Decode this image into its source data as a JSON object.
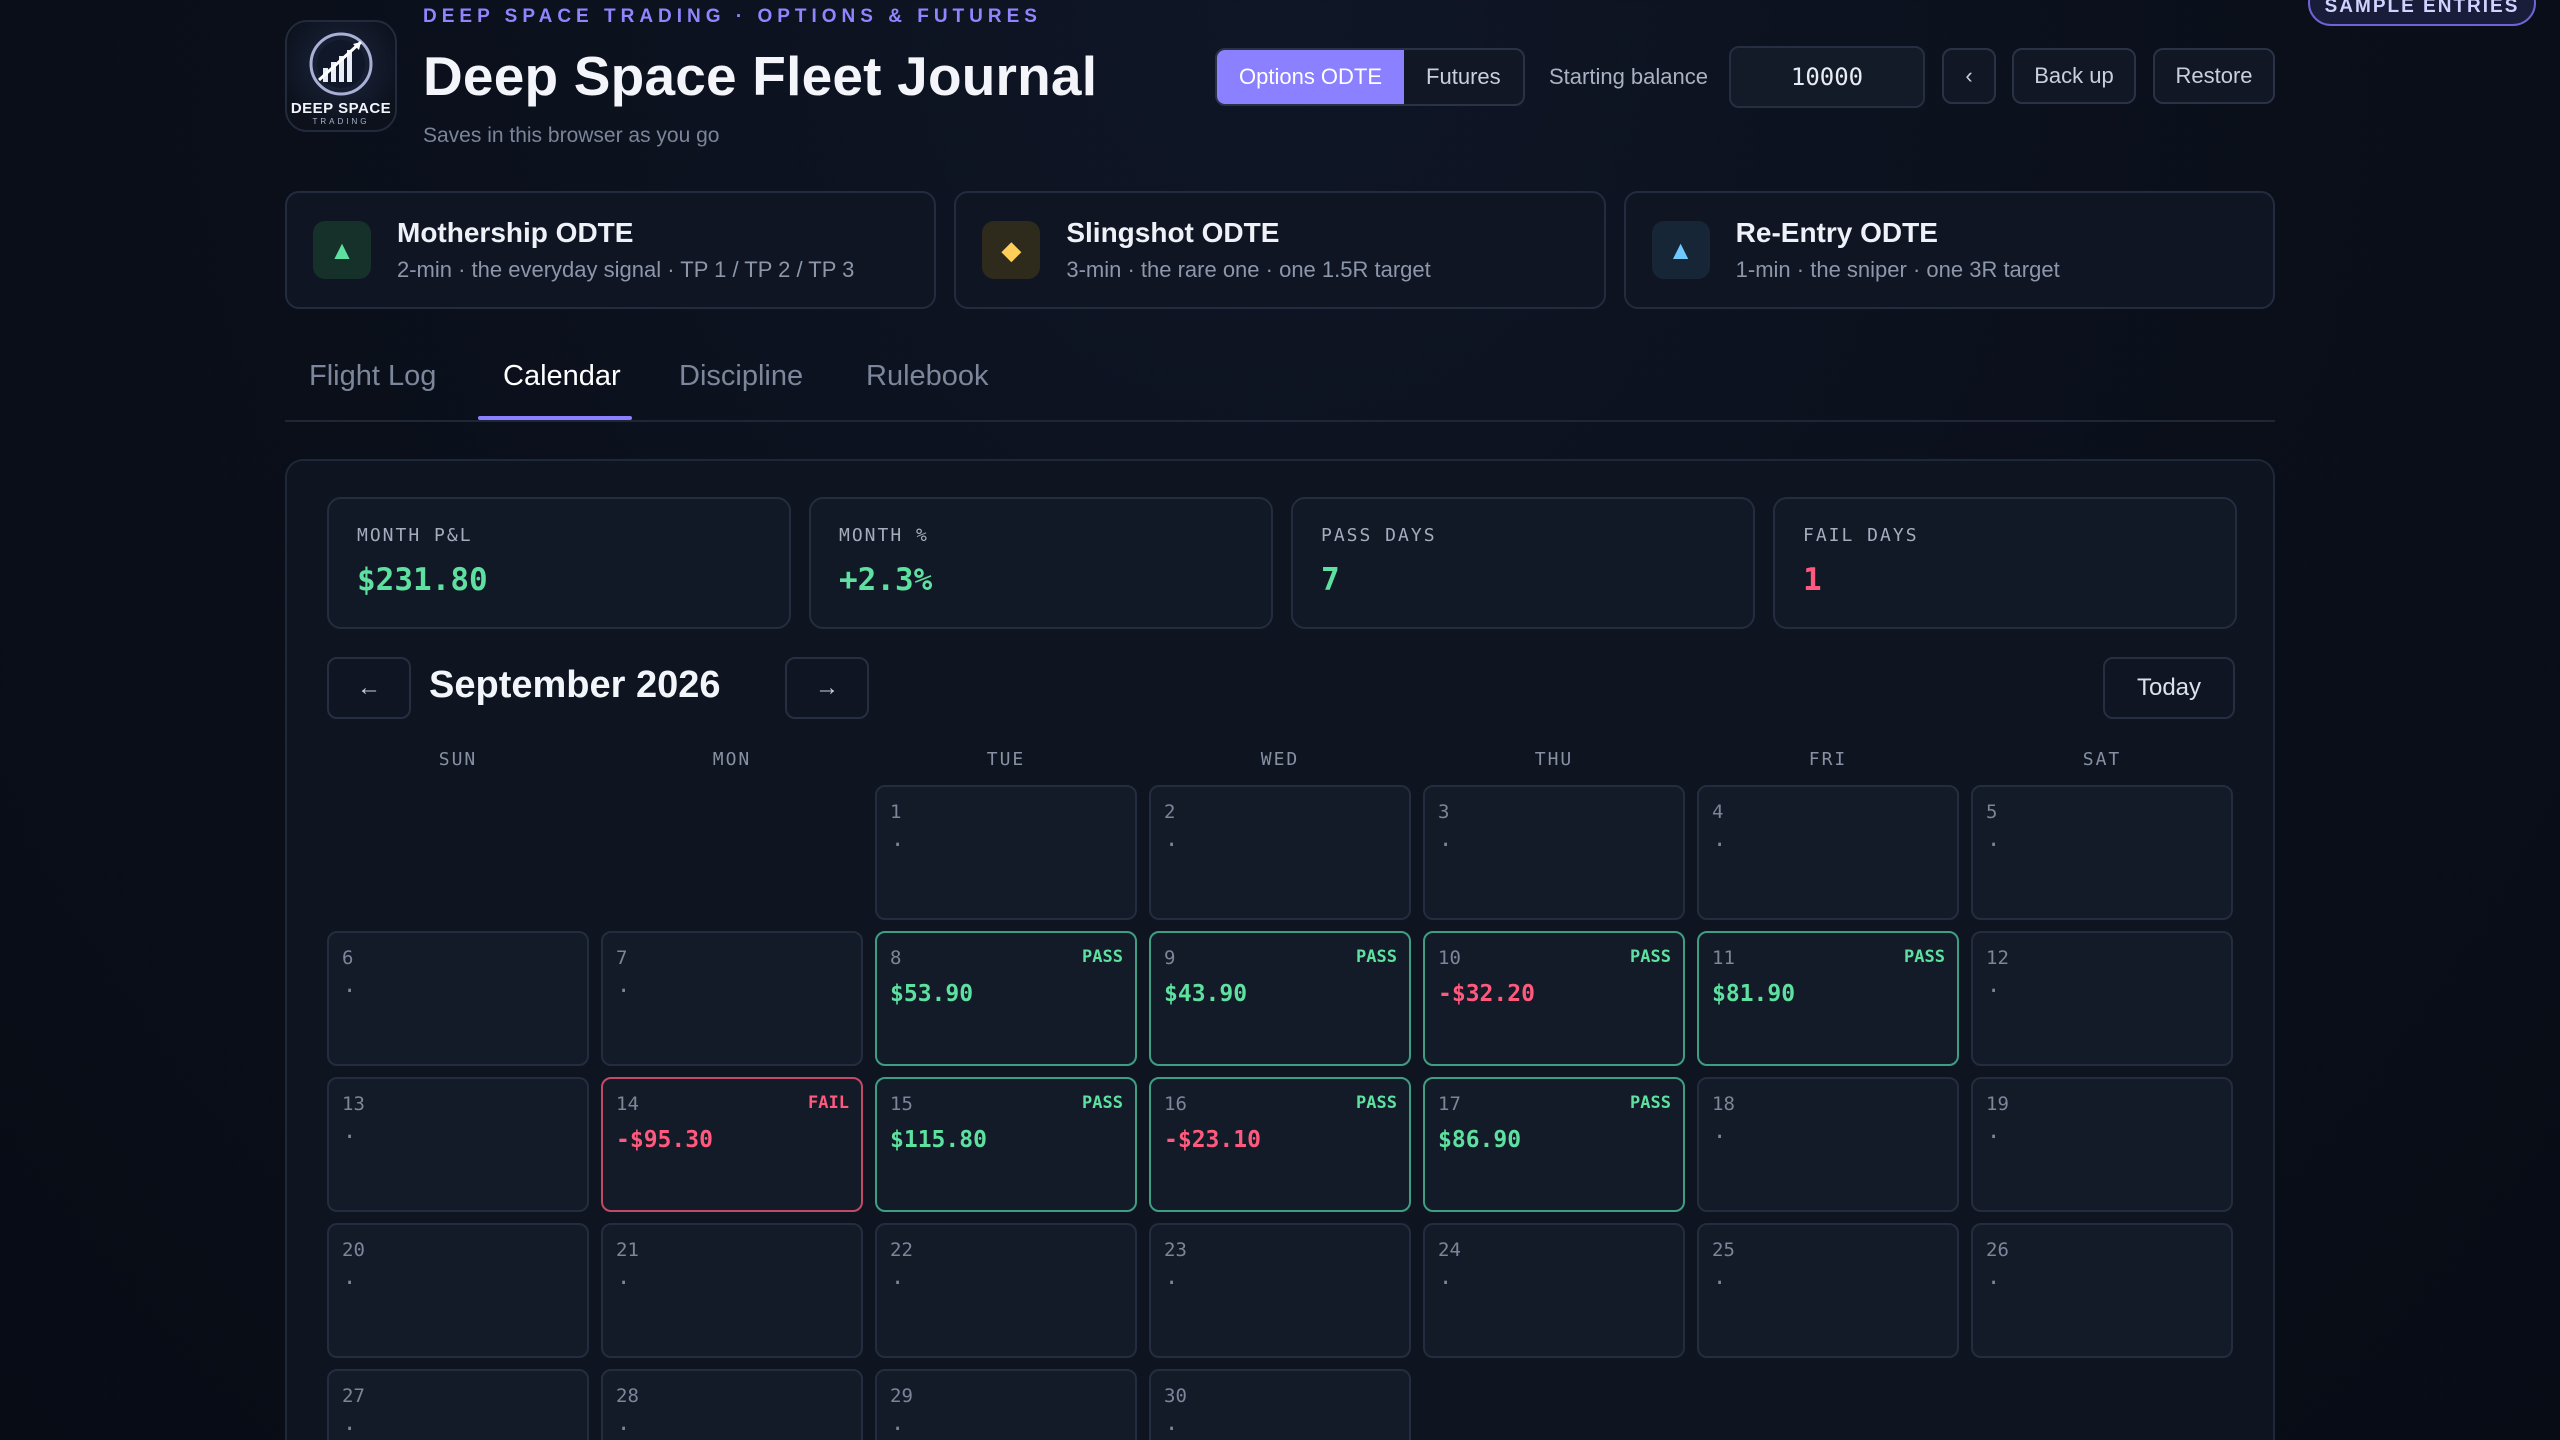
{
  "header": {
    "kicker": "DEEP SPACE TRADING · OPTIONS & FUTURES",
    "title": "Deep Space Fleet Journal",
    "subtitle": "Saves in this browser as you go",
    "logo": {
      "name": "DEEP SPACE",
      "sub": "TRADING"
    },
    "mode_options": [
      "Options ODTE",
      "Futures"
    ],
    "starting_balance_label": "Starting balance",
    "starting_balance_value": "10000",
    "collapse_label": "‹",
    "backup_label": "Back up",
    "restore_label": "Restore",
    "sample_badge": "SAMPLE ENTRIES"
  },
  "strategies": [
    {
      "name": "Mothership ODTE",
      "desc": "2-min · the everyday signal · TP 1 / TP 2 / TP 3",
      "icon": "▲",
      "icon_color": "#5ee0a0",
      "icon_bg": "#16302a"
    },
    {
      "name": "Slingshot ODTE",
      "desc": "3-min · the rare one · one 1.5R target",
      "icon": "◆",
      "icon_color": "#ffcf5a",
      "icon_bg": "#2e2a1c"
    },
    {
      "name": "Re-Entry ODTE",
      "desc": "1-min · the sniper · one 3R target",
      "icon": "▲",
      "icon_color": "#6fc8ff",
      "icon_bg": "#172637"
    }
  ],
  "tabs": [
    "Flight Log",
    "Calendar",
    "Discipline",
    "Rulebook"
  ],
  "stats": [
    {
      "label": "MONTH P&L",
      "value": "$231.80",
      "tone": "green"
    },
    {
      "label": "MONTH %",
      "value": "+2.3%",
      "tone": "green"
    },
    {
      "label": "PASS DAYS",
      "value": "7",
      "tone": "green"
    },
    {
      "label": "FAIL DAYS",
      "value": "1",
      "tone": "red"
    }
  ],
  "calendar": {
    "month_label": "September 2026",
    "prev_label": "←",
    "next_label": "→",
    "today_label": "Today",
    "weekdays": [
      "SUN",
      "MON",
      "TUE",
      "WED",
      "THU",
      "FRI",
      "SAT"
    ],
    "first_weekday": 2,
    "days_in_month": 30,
    "empty_marker": "·",
    "entries": {
      "8": {
        "pnl": "$53.90",
        "status": "PASS",
        "tone": "green"
      },
      "9": {
        "pnl": "$43.90",
        "status": "PASS",
        "tone": "green"
      },
      "10": {
        "pnl": "-$32.20",
        "status": "PASS",
        "tone": "red"
      },
      "11": {
        "pnl": "$81.90",
        "status": "PASS",
        "tone": "green"
      },
      "14": {
        "pnl": "-$95.30",
        "status": "FAIL",
        "tone": "red"
      },
      "15": {
        "pnl": "$115.80",
        "status": "PASS",
        "tone": "green"
      },
      "16": {
        "pnl": "-$23.10",
        "status": "PASS",
        "tone": "red"
      },
      "17": {
        "pnl": "$86.90",
        "status": "PASS",
        "tone": "green"
      }
    }
  }
}
